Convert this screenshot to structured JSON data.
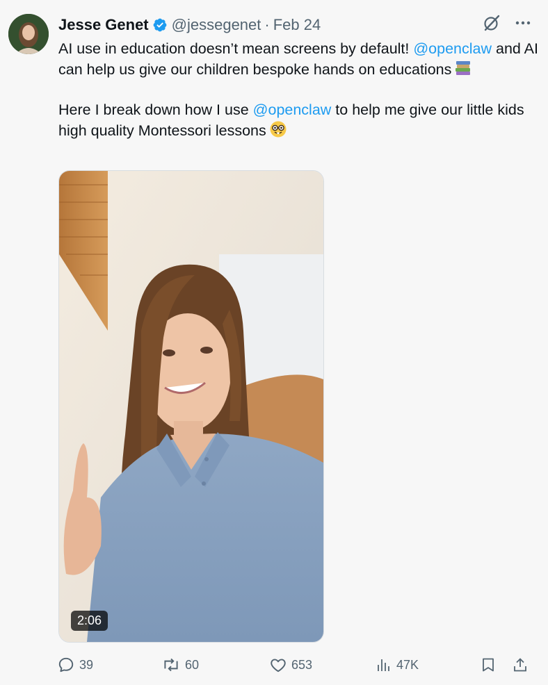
{
  "author": {
    "name": "Jesse Genet",
    "handle": "@jessegenet",
    "separator": "·",
    "date": "Feb 24",
    "verified": true,
    "avatar_icon": "profile-photo"
  },
  "tweet": {
    "p1_part1": "AI use in education doesn’t mean screens by default! ",
    "p1_mention": "@openclaw",
    "p1_part2": " and AI can help us give our children bespoke hands on educations",
    "p1_emoji": "books-emoji",
    "p2_part1": "Here I break down how I use ",
    "p2_mention": "@openclaw",
    "p2_part2": " to help me give our little kids high quality Montessori lessons",
    "p2_emoji": "nerd-face-emoji"
  },
  "media": {
    "type": "video",
    "duration": "2:06"
  },
  "actions": {
    "replies": "39",
    "reposts": "60",
    "likes": "653",
    "views": "47K"
  },
  "colors": {
    "accent": "#1d9bf0",
    "text": "#0f1419",
    "secondary": "#536471",
    "background": "#f7f7f7"
  },
  "icons": [
    "grok-icon",
    "more-icon",
    "reply-icon",
    "repost-icon",
    "like-icon",
    "views-icon",
    "bookmark-icon",
    "share-icon"
  ]
}
